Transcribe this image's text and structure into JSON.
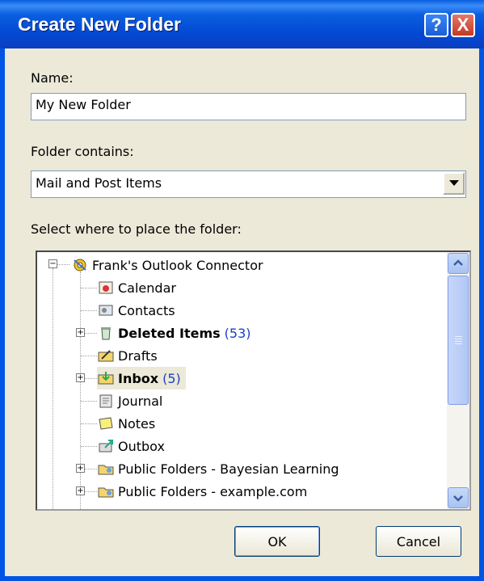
{
  "window": {
    "title": "Create New Folder",
    "help_label": "?",
    "close_label": "X"
  },
  "name_label": "Name:",
  "name_value": "My New Folder",
  "contains_label": "Folder contains:",
  "contains_value": "Mail and Post Items",
  "place_label": "Select where to place the folder:",
  "tree": {
    "root": "Frank's Outlook Connector",
    "items": [
      {
        "label": "Calendar",
        "count": "",
        "bold": false,
        "icon": "calendar-icon"
      },
      {
        "label": "Contacts",
        "count": "",
        "bold": false,
        "icon": "contacts-icon"
      },
      {
        "label": "Deleted Items",
        "count": "(53)",
        "bold": true,
        "icon": "trash-icon"
      },
      {
        "label": "Drafts",
        "count": "",
        "bold": false,
        "icon": "drafts-icon"
      },
      {
        "label": "Inbox",
        "count": "(5)",
        "bold": true,
        "icon": "inbox-icon"
      },
      {
        "label": "Journal",
        "count": "",
        "bold": false,
        "icon": "journal-icon"
      },
      {
        "label": "Notes",
        "count": "",
        "bold": false,
        "icon": "notes-icon"
      },
      {
        "label": "Outbox",
        "count": "",
        "bold": false,
        "icon": "outbox-icon"
      },
      {
        "label": "Public Folders - Bayesian Learning",
        "count": "",
        "bold": false,
        "icon": "public-folder-icon"
      },
      {
        "label": "Public Folders - example.com",
        "count": "",
        "bold": false,
        "icon": "public-folder-icon"
      }
    ]
  },
  "buttons": {
    "ok": "OK",
    "cancel": "Cancel"
  },
  "colors": {
    "title_bar": "#0a5fe0",
    "dialog_bg": "#ece9d8",
    "count": "#1b3fc9"
  }
}
